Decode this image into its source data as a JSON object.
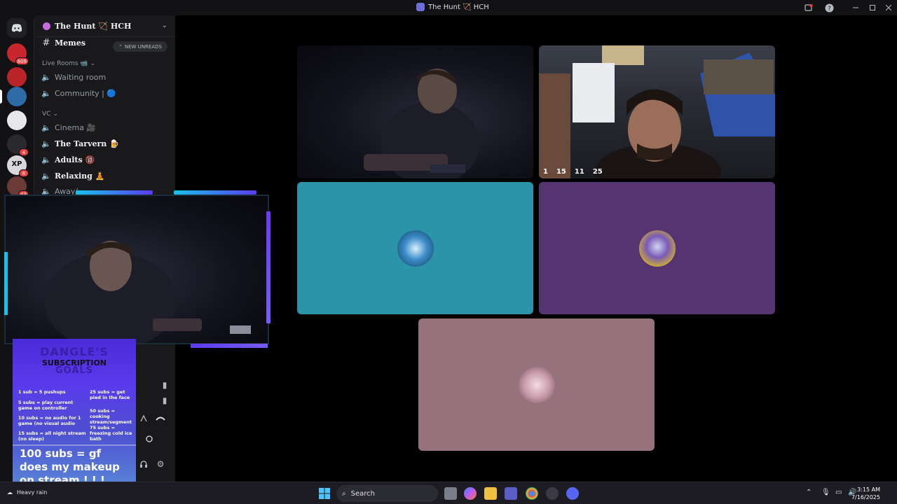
{
  "window": {
    "title": "The Hunt 🏹 HCH"
  },
  "rail": {
    "servers": [
      {
        "name": "server-1",
        "badge": "609",
        "color": "#c8282d"
      },
      {
        "name": "server-2",
        "badge": "",
        "color": "#b8242a"
      },
      {
        "name": "server-3",
        "badge": "",
        "color": "#2e6aa8"
      },
      {
        "name": "server-4",
        "badge": "",
        "color": "#e8e8ec"
      },
      {
        "name": "server-5",
        "badge": "4",
        "color": "#2a2a2e"
      },
      {
        "name": "server-6",
        "badge": "8",
        "color": "#d8d8dc",
        "text": "XP"
      },
      {
        "name": "server-7",
        "badge": "43",
        "color": "#6a3a36"
      }
    ]
  },
  "sidebar": {
    "guild_name": "The Hunt 🏹 HCH",
    "new_unreads": "NEW UNREADS",
    "channels": [
      {
        "id": "memes",
        "label": "Memes",
        "type": "text",
        "bold": true
      },
      {
        "id": "waiting-room",
        "label": "Waiting room",
        "type": "voice",
        "bold": false
      },
      {
        "id": "community",
        "label": "Community | 🔵",
        "type": "voice",
        "bold": false
      },
      {
        "id": "cinema",
        "label": "Cinema 🎥",
        "type": "voice",
        "bold": false
      },
      {
        "id": "the-tarvern",
        "label": "The Tarvern 🍺",
        "type": "voice",
        "bold": true
      },
      {
        "id": "adults",
        "label": "Adults 🔞",
        "type": "voice",
        "bold": true
      },
      {
        "id": "relaxing",
        "label": "Relaxing 🧘",
        "type": "voice",
        "bold": true
      },
      {
        "id": "away",
        "label": "Away/",
        "type": "voice",
        "bold": false
      }
    ],
    "categories": {
      "live_rooms": "Live Rooms 📹",
      "vc": "VC"
    }
  },
  "stage": {
    "stats": [
      "1",
      "15",
      "11",
      "25"
    ],
    "tiles": [
      {
        "id": "tile-user-webcam",
        "kind": "camera"
      },
      {
        "id": "tile-streamer-webcam",
        "kind": "camera"
      },
      {
        "id": "tile-avatar-teal",
        "kind": "avatar",
        "bg": "#2b94a8"
      },
      {
        "id": "tile-avatar-purple",
        "kind": "avatar",
        "bg": "#563371"
      },
      {
        "id": "tile-avatar-pink",
        "kind": "avatar",
        "bg": "#96727c"
      }
    ]
  },
  "goals": {
    "heading_1": "DANGLE'S",
    "heading_2": "SUBSCRIPTION",
    "heading_3": "GOALS",
    "left_items": [
      "1 sub = 5 pushups",
      "5 subs = play current game on controller",
      "10 subs = no audio for 1 game (no visual audio",
      "15 subs = all night stream (no sleep)"
    ],
    "right_items": [
      "25 subs = get pied in the face",
      "50 subs = cooking stream/segment",
      "75 subs = freezing cold ice bath"
    ],
    "big_text": "100 subs = gf does my makeup on stream ! ! !"
  },
  "taskbar": {
    "search_label": "Search",
    "weather": "Heavy rain",
    "time": "3:15 AM",
    "date": "7/16/2025"
  }
}
